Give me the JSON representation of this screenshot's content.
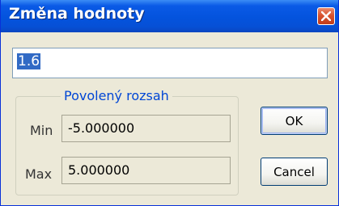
{
  "dialog": {
    "title": "Změna hodnoty",
    "value": "1.6"
  },
  "range": {
    "legend": "Povolený rozsah",
    "min_label": "Min",
    "min_value": "-5.000000",
    "max_label": "Max",
    "max_value": "5.000000"
  },
  "buttons": {
    "ok": "OK",
    "cancel": "Cancel"
  },
  "colors": {
    "title_bar": "#0453dd",
    "close_button": "#d8532f",
    "selection": "#316ac5",
    "dialog_bg": "#ece9d8",
    "legend_text": "#0046d5"
  }
}
